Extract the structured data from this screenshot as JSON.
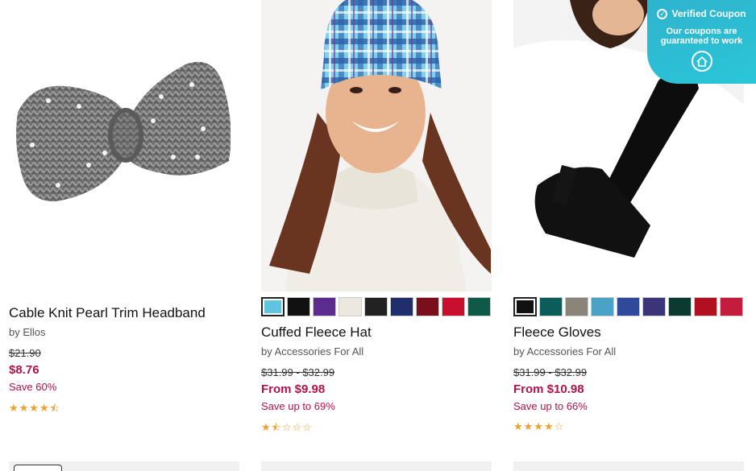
{
  "products": [
    {
      "title": "Cable Knit Pearl Trim Headband",
      "brand": "by Ellos",
      "old_price": "$21.90",
      "price": "$8.76",
      "save": "Save 60%",
      "rating": 4.5,
      "rating_stars": "★★★★⯪"
    },
    {
      "title": "Cuffed Fleece Hat",
      "brand": "by Accessories For All",
      "old_price": "$31.99 - $32.99",
      "price": "From $9.98",
      "save": "Save up to 69%",
      "rating": 1.5,
      "rating_stars": "★⯪☆☆☆",
      "swatches": [
        "#5fc4e0",
        "#111111",
        "#5b2c8e",
        "#ece8df",
        "#222222",
        "#1f2f6b",
        "#7a0f1c",
        "#c8102e",
        "#0e5a48"
      ]
    },
    {
      "title": "Fleece Gloves",
      "brand": "by Accessories For All",
      "old_price": "$31.99 - $32.99",
      "price": "From $10.98",
      "save": "Save up to 66%",
      "rating": 4,
      "rating_stars": "★★★★☆",
      "swatches": [
        "#111111",
        "#0d5c5c",
        "#8a8478",
        "#4aa3c6",
        "#2f4a9a",
        "#3a3578",
        "#0a3a30",
        "#b01020",
        "#c41c3c",
        "#eeeae2",
        "#333333",
        "#555555"
      ]
    }
  ],
  "coupon": {
    "title": "Verified Coupon",
    "subtitle": "Our coupons are guaranteed to work"
  },
  "colors": {
    "sale": "#b0124a",
    "coupon_bg": "#2fb3ce",
    "star": "#f0a030"
  }
}
